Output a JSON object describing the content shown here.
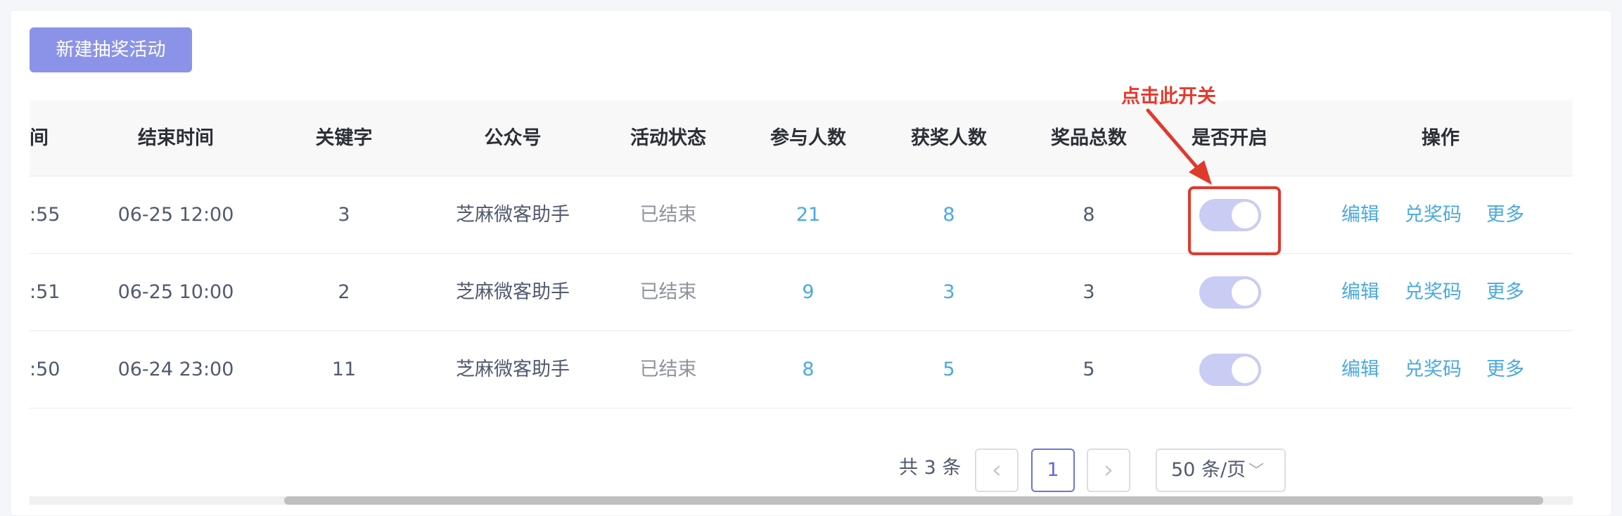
{
  "toolbar": {
    "new_button": "新建抽奖活动"
  },
  "table": {
    "headers": {
      "start_time_partial": "间",
      "end_time": "结束时间",
      "keyword": "关键字",
      "official_account": "公众号",
      "status": "活动状态",
      "participants": "参与人数",
      "winners": "获奖人数",
      "prizes": "奖品总数",
      "enabled": "是否开启",
      "actions": "操作"
    },
    "rows": [
      {
        "start_time_partial": ":55",
        "end_time": "06-25 12:00",
        "keyword": "3",
        "official_account": "芝麻微客助手",
        "status": "已结束",
        "participants": "21",
        "winners": "8",
        "prizes": "8",
        "enabled": true
      },
      {
        "start_time_partial": ":51",
        "end_time": "06-25 10:00",
        "keyword": "2",
        "official_account": "芝麻微客助手",
        "status": "已结束",
        "participants": "9",
        "winners": "3",
        "prizes": "3",
        "enabled": true
      },
      {
        "start_time_partial": ":50",
        "end_time": "06-24 23:00",
        "keyword": "11",
        "official_account": "芝麻微客助手",
        "status": "已结束",
        "participants": "8",
        "winners": "5",
        "prizes": "5",
        "enabled": true
      }
    ],
    "actions": {
      "edit": "编辑",
      "redeem_code": "兑奖码",
      "more": "更多"
    }
  },
  "pagination": {
    "total_text": "共 3 条",
    "prev_icon": "‹",
    "current_page": "1",
    "next_icon": "›",
    "page_size": "50 条/页",
    "page_size_chevron": "﹀"
  },
  "annotation": {
    "text": "点击此开关",
    "color": "#e8392b"
  },
  "colors": {
    "primary": "#8b93e8",
    "link": "#4aa9e2",
    "switch_on": "#c9ccf3",
    "annotation": "#e03a2c"
  }
}
